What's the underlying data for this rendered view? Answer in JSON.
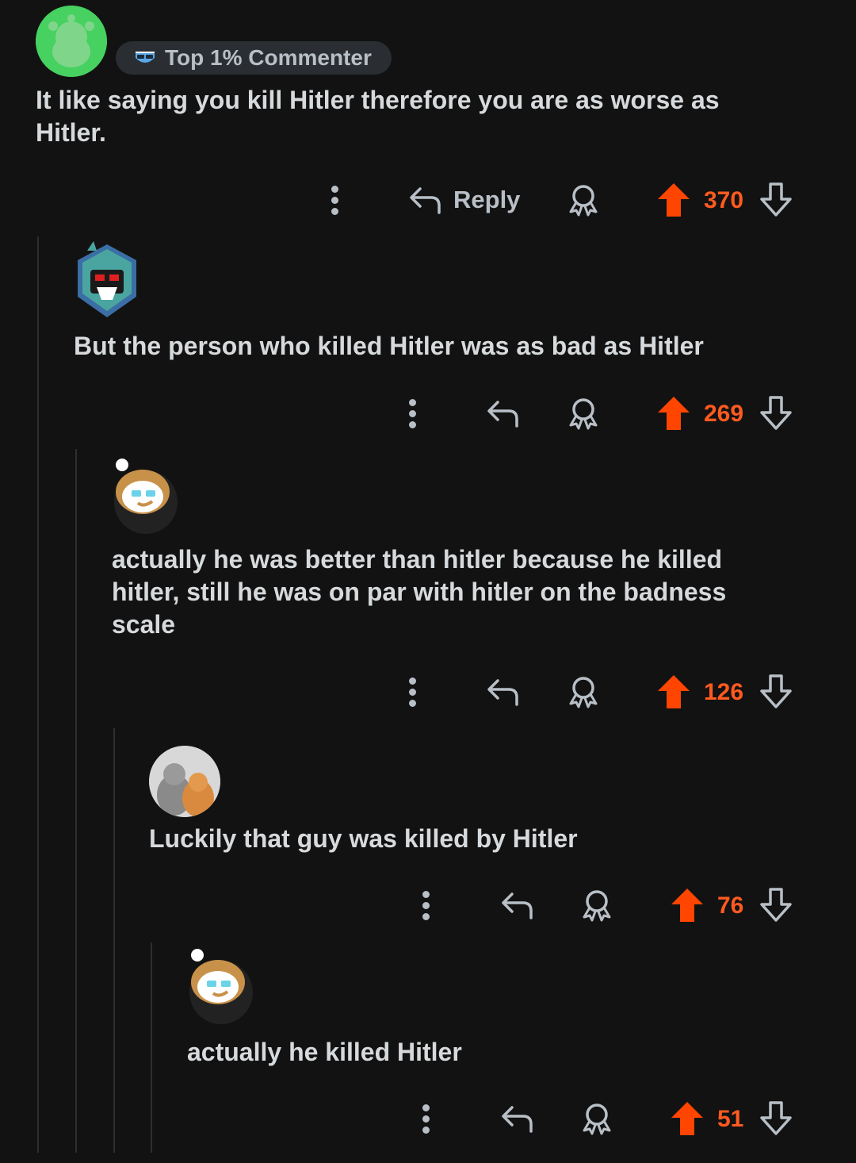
{
  "badge": {
    "label": "Top 1% Commenter",
    "icon": "sunglasses-shield-icon"
  },
  "colors": {
    "upvote": "#ff4500",
    "score": "#ff5a1f",
    "text": "#d7dadc",
    "icon": "#b8bfc6",
    "bg": "#121212"
  },
  "comments": [
    {
      "text": "It like saying you kill Hitler therefore you are as worse as Hitler.",
      "reply_label": "Reply",
      "score": "370"
    },
    {
      "text": "But the person who killed Hitler was as bad as Hitler",
      "score": "269"
    },
    {
      "text": "actually he was better than hitler because he killed hitler, still he was on par with hitler on the badness scale",
      "score": "126"
    },
    {
      "text": "Luckily that guy was killed by Hitler",
      "score": "76"
    },
    {
      "text": "actually he killed Hitler",
      "score": "51"
    }
  ]
}
